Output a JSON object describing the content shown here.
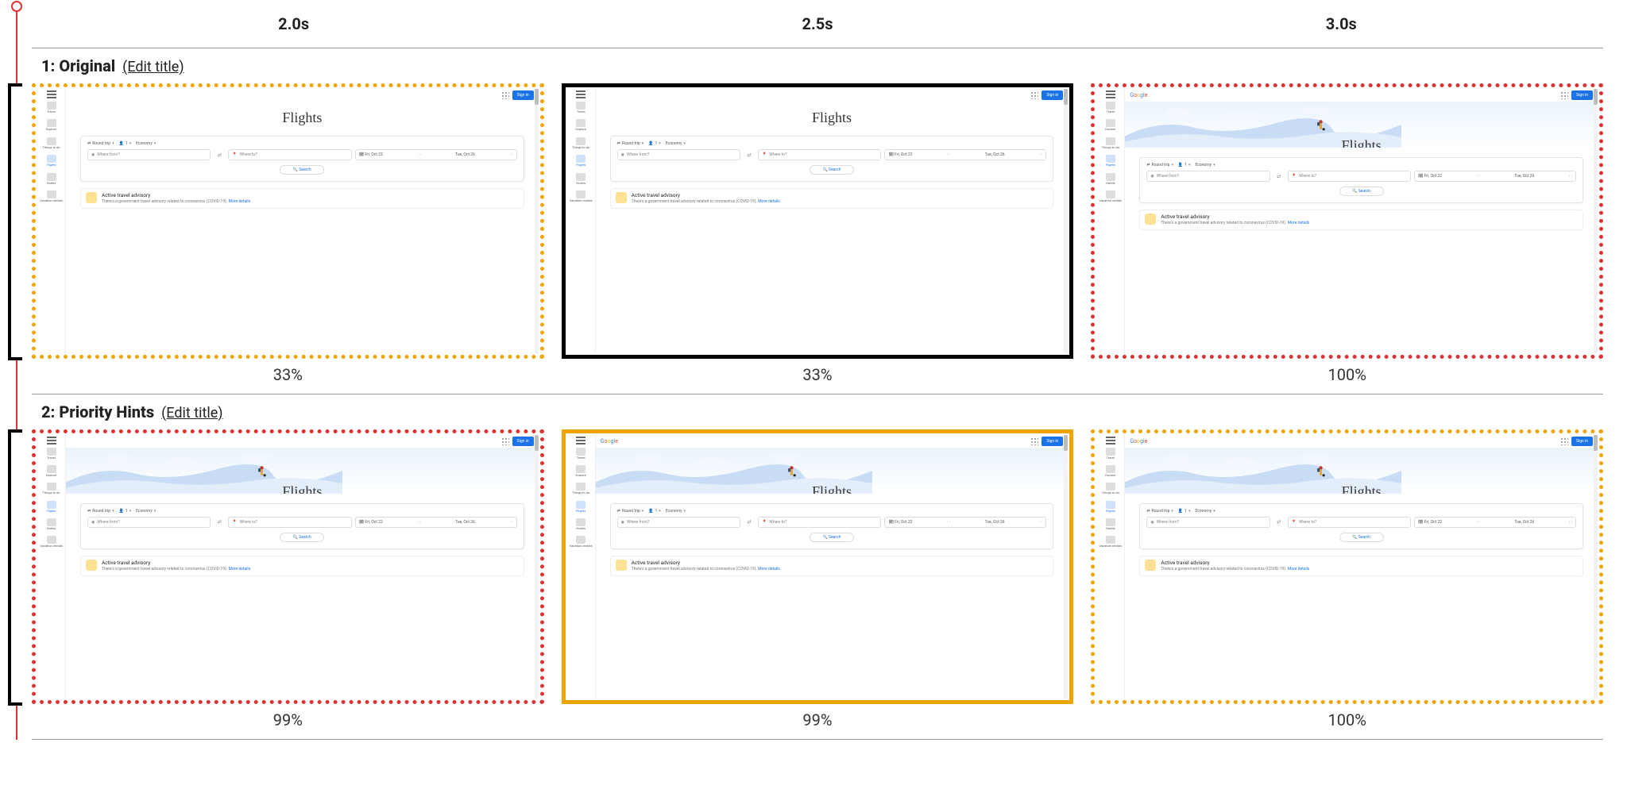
{
  "timesteps": [
    "2.0s",
    "2.5s",
    "3.0s"
  ],
  "edit_title_label": "(Edit title)",
  "runs": [
    {
      "title": "1: Original",
      "frames": [
        {
          "border": "border-dotted-orange",
          "pct": "33%",
          "hero_loaded": false,
          "logo_visible": false
        },
        {
          "border": "border-solid-black",
          "pct": "33%",
          "hero_loaded": false,
          "logo_visible": false
        },
        {
          "border": "border-dotted-red",
          "pct": "100%",
          "hero_loaded": true,
          "logo_visible": true
        }
      ]
    },
    {
      "title": "2: Priority Hints",
      "frames": [
        {
          "border": "border-dotted-red",
          "pct": "99%",
          "hero_loaded": true,
          "logo_visible": false
        },
        {
          "border": "border-solid-orange",
          "pct": "99%",
          "hero_loaded": true,
          "logo_visible": true
        },
        {
          "border": "border-dotted-orange",
          "pct": "100%",
          "hero_loaded": true,
          "logo_visible": true
        }
      ]
    }
  ],
  "flights": {
    "heading": "Flights",
    "sidebar": [
      {
        "label": "Travel"
      },
      {
        "label": "Explore"
      },
      {
        "label": "Things to do"
      },
      {
        "label": "Flights",
        "active": true
      },
      {
        "label": "Hotels"
      },
      {
        "label": "Vacation rentals"
      }
    ],
    "topbar": {
      "logo": "Google",
      "signin": "Sign in"
    },
    "chips": {
      "trip": "Round trip",
      "pax": "1",
      "cabin": "Economy"
    },
    "fields": {
      "from_placeholder": "Where from?",
      "to_placeholder": "Where to?",
      "date_from": "Fri, Oct 22",
      "date_to": "Tue, Oct 26"
    },
    "search_label": "Search",
    "advisory": {
      "headline": "Active travel advisory",
      "sub": "There's a government travel advisory related to coronavirus (COVID-19).",
      "more": "More details"
    }
  }
}
